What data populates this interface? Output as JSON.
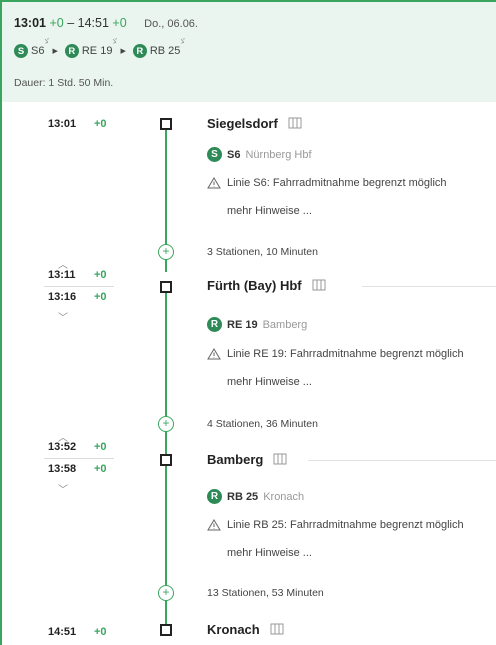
{
  "header": {
    "dep_time": "13:01",
    "dep_delay": "+0",
    "dash": "–",
    "arr_time": "14:51",
    "arr_delay": "+0",
    "date": "Do., 06.06.",
    "lines": [
      {
        "badge": "S",
        "name": "S6",
        "sup": "ゞ"
      },
      {
        "badge": "R",
        "name": "RE 19",
        "sup": "ゞ"
      },
      {
        "badge": "R",
        "name": "RB 25",
        "sup": "ゞ"
      }
    ],
    "duration": "Dauer: 1 Std. 50 Min."
  },
  "stops": [
    {
      "arr_time": "",
      "arr_delay": "",
      "dep_time": "13:01",
      "dep_delay": "+0",
      "name": "Siegelsdorf"
    },
    {
      "arr_time": "13:11",
      "arr_delay": "+0",
      "dep_time": "13:16",
      "dep_delay": "+0",
      "name": "Fürth (Bay) Hbf"
    },
    {
      "arr_time": "13:52",
      "arr_delay": "+0",
      "dep_time": "13:58",
      "dep_delay": "+0",
      "name": "Bamberg"
    },
    {
      "arr_time": "14:51",
      "arr_delay": "+0",
      "dep_time": "",
      "dep_delay": "",
      "name": "Kronach"
    }
  ],
  "legs": [
    {
      "badge": "S",
      "line": "S6",
      "destination": "Nürnberg Hbf",
      "notice": "Linie S6: Fahrradmitnahme begrenzt möglich",
      "more": "mehr Hinweise ...",
      "segment": "3 Stationen, 10 Minuten"
    },
    {
      "badge": "R",
      "line": "RE 19",
      "destination": "Bamberg",
      "notice": "Linie RE 19: Fahrradmitnahme begrenzt möglich",
      "more": "mehr Hinweise ...",
      "segment": "4 Stationen, 36 Minuten"
    },
    {
      "badge": "R",
      "line": "RB 25",
      "destination": "Kronach",
      "notice": "Linie RB 25: Fahrradmitnahme begrenzt möglich",
      "more": "mehr Hinweise ...",
      "segment": "13 Stationen, 53 Minuten"
    }
  ],
  "colors": {
    "accent": "#3aa55f",
    "header_bg": "#e9f5ee",
    "line_badge": "#2e8b57"
  }
}
